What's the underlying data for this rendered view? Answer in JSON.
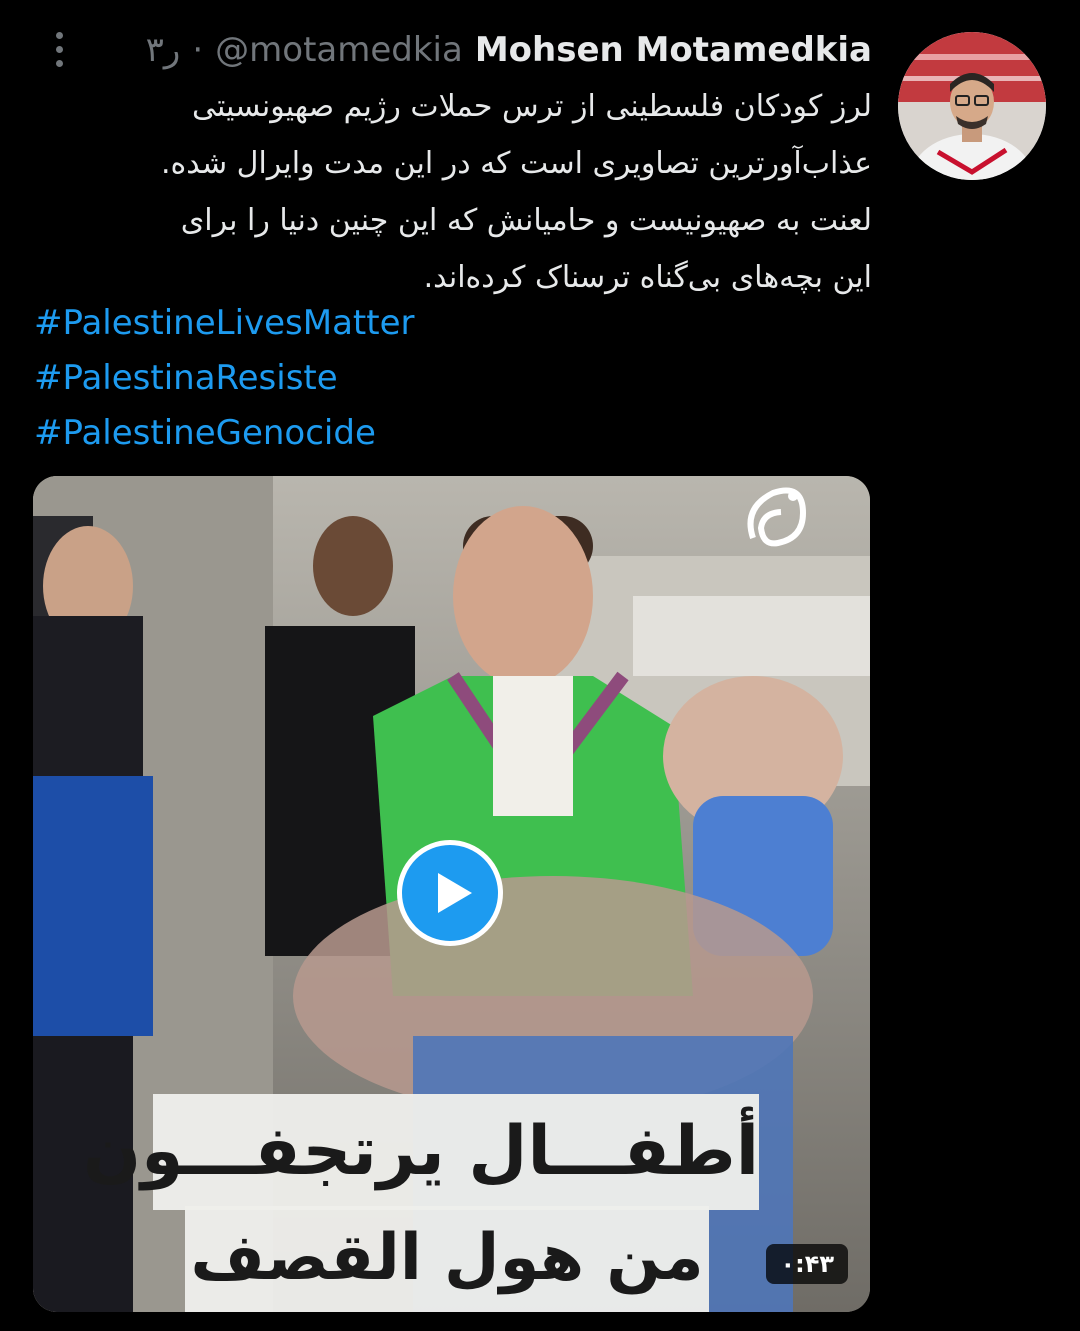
{
  "tweet": {
    "author_name": "Mohsen Motamedkia",
    "handle": "@motamedkia",
    "separator": "·",
    "time": "۳ر",
    "text_lines": [
      "لرز کودکان فلسطینی از ترس حملات رژیم صهیونسیتی",
      "عذاب‌آورترین تصاویری است که در این مدت وایرال شده.",
      "لعنت به صهیونیست و حامیانش که این چنین دنیا را برای",
      "این بچه‌های بی‌گناه ترسناک کرده‌اند."
    ],
    "hashtags": [
      "#PalestineLivesMatter",
      "#PalestinaResiste",
      "#PalestineGenocide"
    ]
  },
  "media": {
    "caption_line1": "أطفـــال يرتجفـــون",
    "caption_line2": "من هول القصف",
    "duration": "۰:۴۳"
  },
  "colors": {
    "background": "#000000",
    "text": "#e7e9ea",
    "muted": "#71767b",
    "link": "#1d9bf0",
    "play_button": "#1d9bf0"
  },
  "icons": {
    "more": "more-vertical-icon",
    "play": "play-icon",
    "logo": "channel-logo-icon"
  }
}
